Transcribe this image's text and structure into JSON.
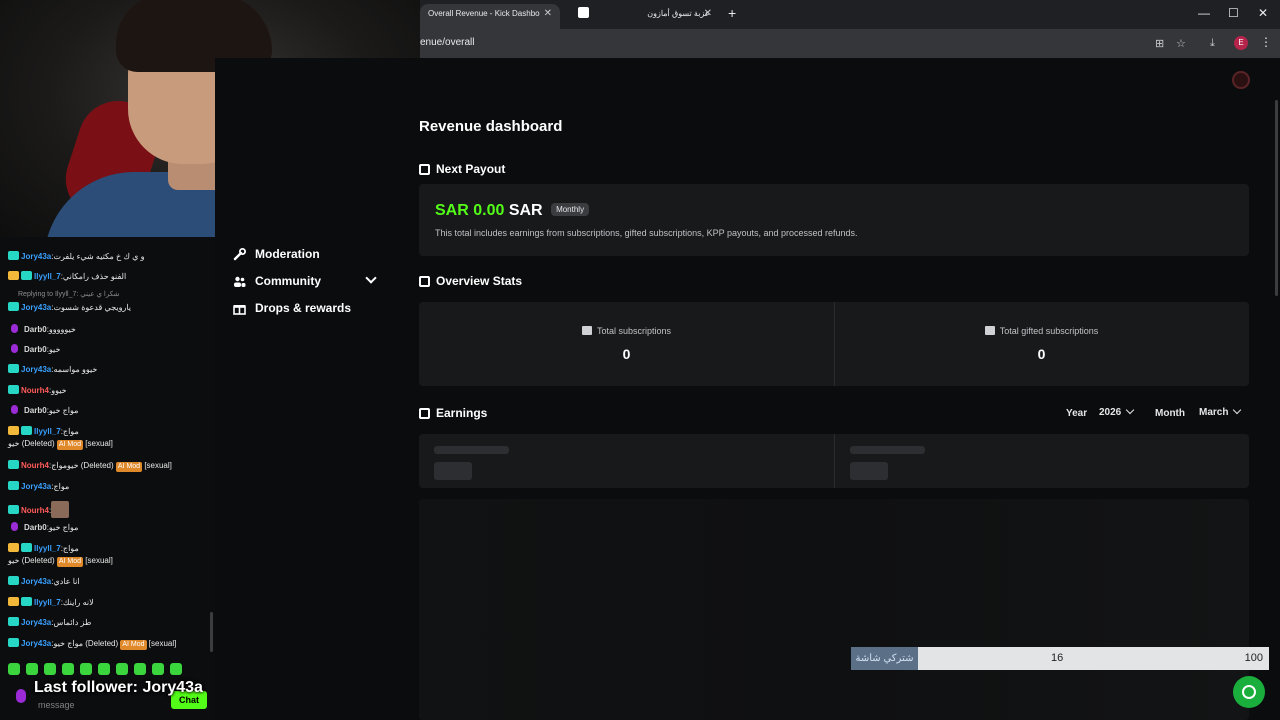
{
  "browser": {
    "tabs": [
      {
        "title": "Overall Revenue - Kick Dashbo",
        "active": true
      },
      {
        "title": "عزبة تسوق أمازون",
        "active": false
      }
    ],
    "url": "enue/overall",
    "profile_initial": "E"
  },
  "dashboard": {
    "title": "Revenue dashboard",
    "sidebar": [
      {
        "label": "Moderation",
        "icon": "wrench-icon"
      },
      {
        "label": "Community",
        "icon": "people-icon",
        "expandable": true
      },
      {
        "label": "Drops & rewards",
        "icon": "gift-icon"
      }
    ],
    "next_payout": {
      "heading": "Next Payout",
      "amount": "SAR 0.00",
      "currency": "SAR",
      "badge": "Monthly",
      "note": "This total includes earnings from subscriptions, gifted subscriptions, KPP payouts, and processed refunds."
    },
    "overview": {
      "heading": "Overview Stats",
      "stats": [
        {
          "label": "Total subscriptions",
          "value": "0"
        },
        {
          "label": "Total gifted subscriptions",
          "value": "0"
        }
      ]
    },
    "earnings": {
      "heading": "Earnings",
      "year_label": "Year",
      "year_value": "2026",
      "month_label": "Month",
      "month_value": "March"
    }
  },
  "chat": {
    "messages": [
      {
        "user": "Jory43a",
        "text": "و ي ك خ مكتيه شيء يلفرت",
        "badge": "teal",
        "user_color": "#39a0ff"
      },
      {
        "user": "Ilyyll_7",
        "text": "الفنو حذف رامكاني",
        "badge": "gold",
        "user_color": "#39a0ff"
      },
      {
        "reply": "Replying to Ilyyll_7: شكرا ي عيني"
      },
      {
        "user": "Jory43a",
        "text": "يارويجي قدعوة شسوت",
        "badge": "teal",
        "user_color": "#39a0ff"
      },
      {
        "user": "Darb0",
        "text": "خيووووو",
        "badge": "mic",
        "user_color": "#d8d8d8"
      },
      {
        "user": "Darb0",
        "text": "خيو",
        "badge": "mic",
        "user_color": "#d8d8d8"
      },
      {
        "user": "Jory43a",
        "text": "خيوو مواسمه",
        "badge": "teal",
        "user_color": "#39a0ff"
      },
      {
        "user": "Nourh4",
        "text": "خيوو",
        "badge": "teal",
        "user_color": "#ff5b5b"
      },
      {
        "user": "Darb0",
        "text": "مواج خيو",
        "badge": "mic",
        "user_color": "#d8d8d8"
      },
      {
        "user": "Ilyyll_7",
        "text": "مواج",
        "badge": "gold",
        "user_color": "#39a0ff"
      },
      {
        "cont": "خيو (Deleted)",
        "tag": "AI Mod",
        "flag": "[sexual]"
      },
      {
        "user": "Nourh4",
        "text": "خيومواج (Deleted)",
        "badge": "teal",
        "user_color": "#ff5b5b",
        "tag": "AI Mod",
        "flag": "[sexual]"
      },
      {
        "user": "Jory43a",
        "text": "مواج",
        "badge": "teal",
        "user_color": "#39a0ff"
      },
      {
        "user": "Nourh4",
        "text": "",
        "badge": "teal",
        "user_color": "#ff5b5b",
        "image": true
      },
      {
        "user": "Darb0",
        "text": "مواج خيو",
        "badge": "mic",
        "user_color": "#d8d8d8"
      },
      {
        "user": "Ilyyll_7",
        "text": "مواج",
        "badge": "gold",
        "user_color": "#39a0ff"
      },
      {
        "cont": "خيو (Deleted)",
        "tag": "AI Mod",
        "flag": "[sexual]"
      },
      {
        "user": "Jory43a",
        "text": "انا عادي",
        "badge": "teal",
        "user_color": "#39a0ff"
      },
      {
        "user": "Ilyyll_7",
        "text": "لانه راينك",
        "badge": "gold",
        "user_color": "#39a0ff"
      },
      {
        "user": "Jory43a",
        "text": "طز دائماس",
        "badge": "teal",
        "user_color": "#39a0ff"
      },
      {
        "user": "Jory43a",
        "text": "مواج خيو (Deleted)",
        "badge": "teal",
        "user_color": "#39a0ff",
        "tag": "AI Mod",
        "flag": "[sexual]"
      }
    ],
    "input_placeholder": "message",
    "send_label": "Chat"
  },
  "overlay": {
    "last_follower": "Last follower: Jory43a",
    "goal_label": "شتركي شاشة",
    "goal_current": "16",
    "goal_max": "100",
    "goal_progress": 0.16
  },
  "colors": {
    "accent": "#53fc18",
    "background": "#0b0c0d",
    "card": "#18191b"
  }
}
